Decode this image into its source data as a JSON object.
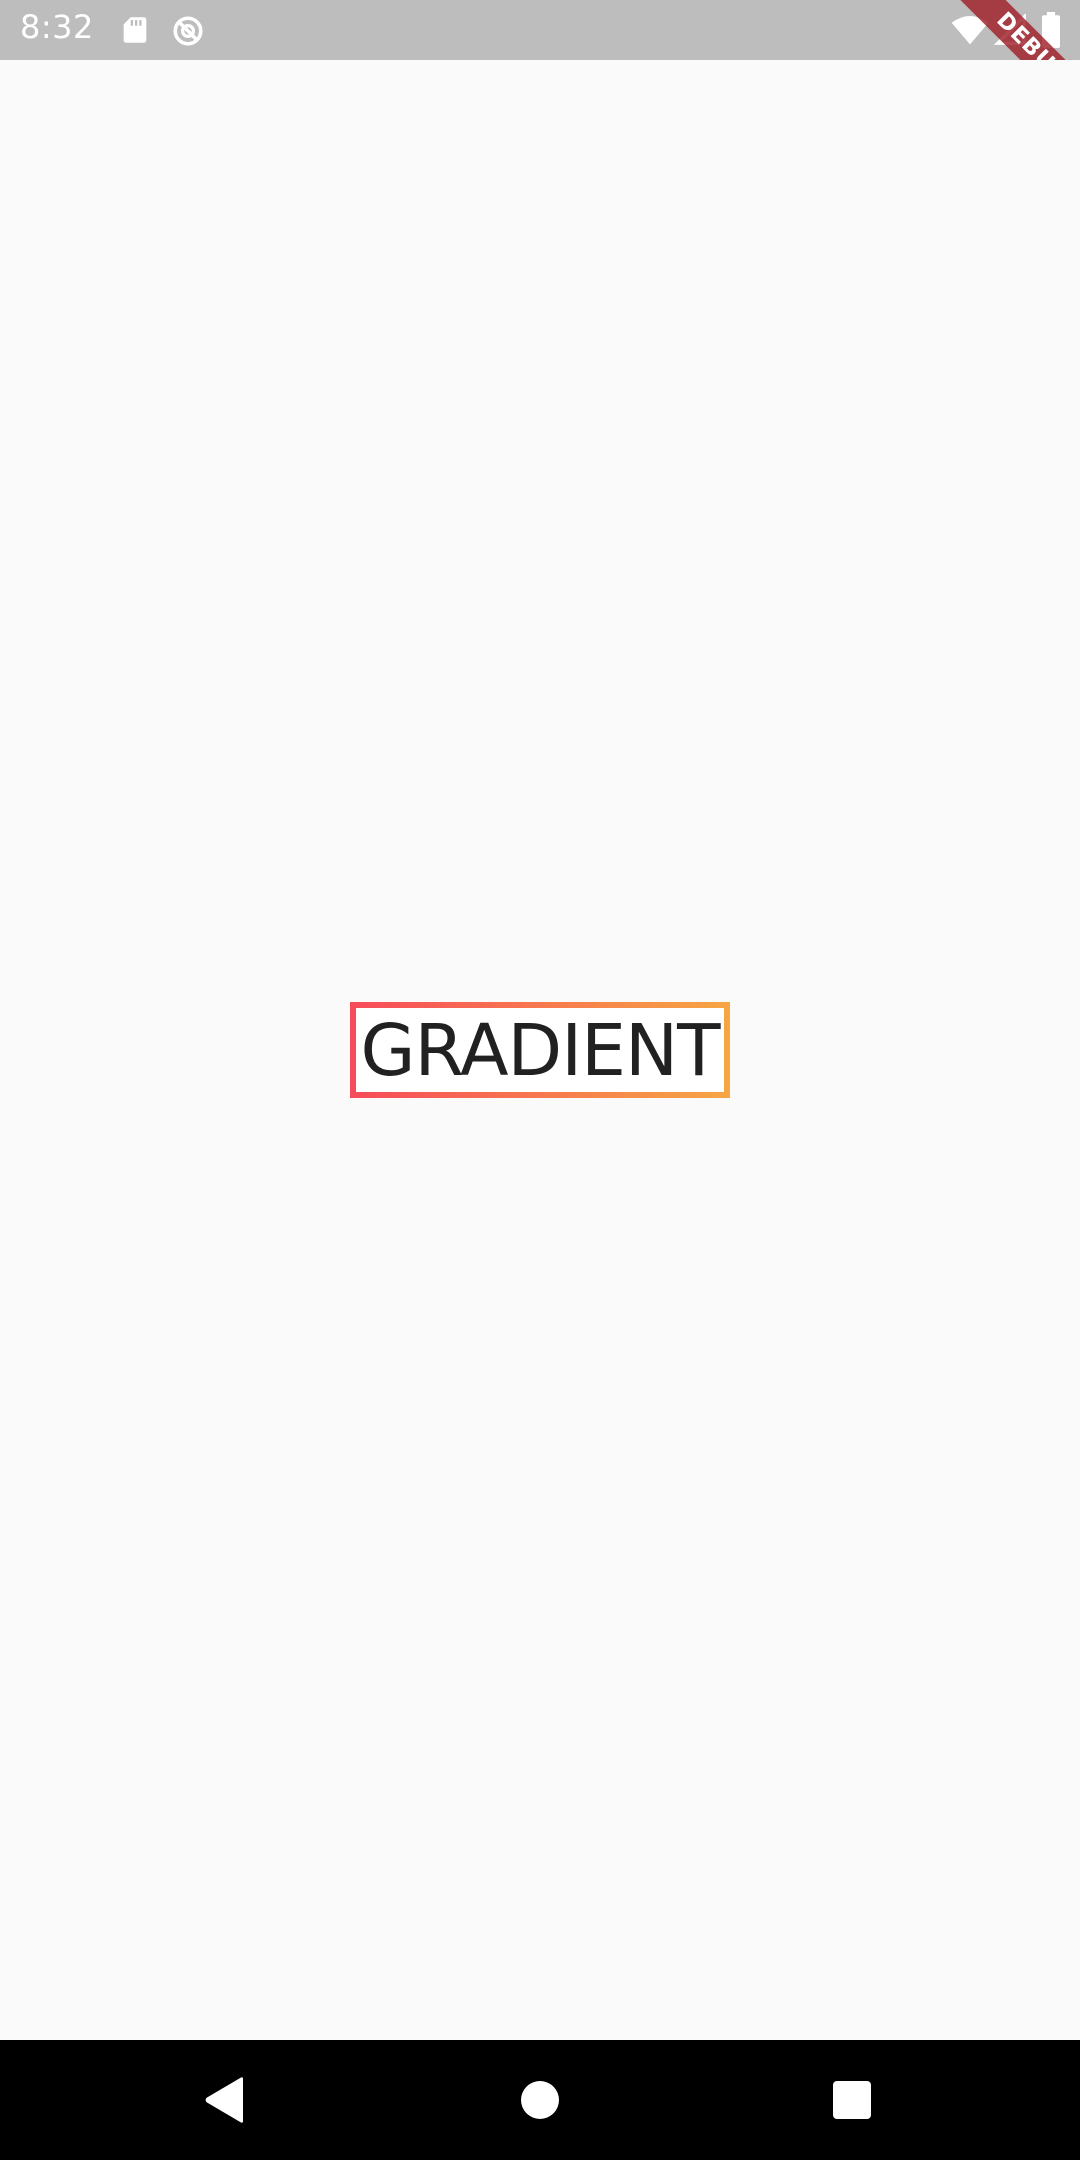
{
  "status_bar": {
    "time": "8:32",
    "left_icons": [
      "sd-card-icon",
      "data-saver-icon"
    ],
    "right_icons": [
      "wifi-icon",
      "signal-icon",
      "battery-icon"
    ]
  },
  "debug_banner": {
    "label": "DEBUG"
  },
  "main": {
    "gradient_label": "GRADIENT",
    "gradient_colors": [
      "#f74b5a",
      "#f7784e",
      "#f6a643"
    ]
  },
  "nav_bar": {
    "buttons": [
      "back-icon",
      "home-icon",
      "recents-icon"
    ]
  },
  "colors": {
    "status_bar_bg": "#bdbdbd",
    "page_bg": "#fafafa",
    "nav_bar_bg": "#000000",
    "debug_banner": "#a01e28"
  }
}
